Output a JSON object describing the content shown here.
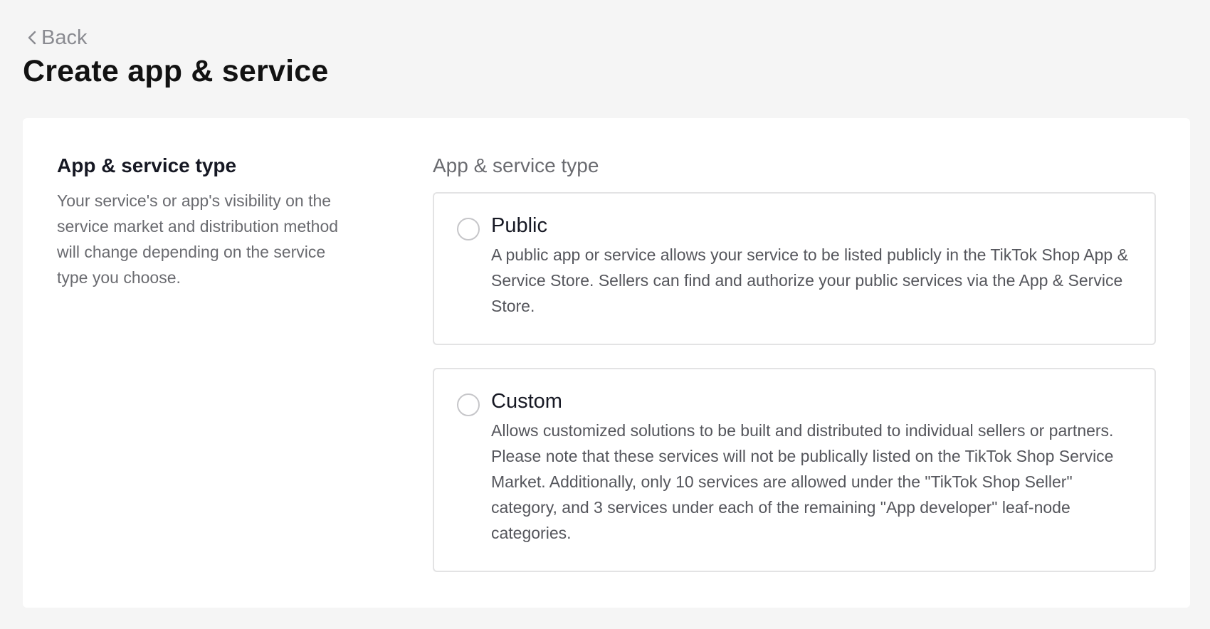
{
  "header": {
    "back_label": "Back",
    "title": "Create app & service"
  },
  "left_panel": {
    "title": "App & service type",
    "description": "Your service's or app's visibility on the service market and distribution method will change depending on the service type you choose."
  },
  "form": {
    "field_label": "App & service type",
    "options": [
      {
        "title": "Public",
        "description": "A public app or service allows your service to be listed publicly in the TikTok Shop App & Service Store. Sellers can find and authorize your public services via the App & Service Store.",
        "selected": false
      },
      {
        "title": "Custom",
        "description": "Allows customized solutions to be built and distributed to individual sellers or partners. Please note that these services will not be publically listed on the TikTok Shop Service Market. Additionally, only 10 services are allowed under the \"TikTok Shop Seller\" category, and 3 services under each of the remaining \"App developer\" leaf-node categories.",
        "selected": false
      }
    ]
  },
  "icons": {
    "back": "chevron-left-icon"
  }
}
